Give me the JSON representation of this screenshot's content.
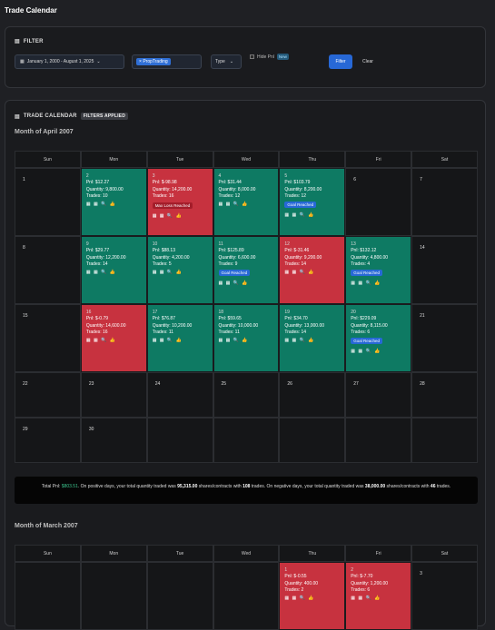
{
  "page_title": "Trade Calendar",
  "filter": {
    "title": "FILTER",
    "date_range": "January 1, 2000 - August 1, 2025",
    "tag": "PropTrading",
    "type_label": "Type",
    "hide_label": "Hide Pnl",
    "new_badge": "New",
    "filter_button": "Filter",
    "clear_button": "Clear"
  },
  "calendar": {
    "title": "TRADE CALENDAR",
    "badge": "FILTERS APPLIED",
    "weekdays": [
      "Sun",
      "Mon",
      "Tue",
      "Wed",
      "Thu",
      "Fri",
      "Sat"
    ]
  },
  "april": {
    "title": "Month of April 2007",
    "days": [
      {
        "d": "1",
        "t": "empty"
      },
      {
        "d": "2",
        "t": "pos",
        "pnl": "Pnl: $12.27",
        "qty": "Quantity: 9,800.00",
        "trades": "Trades: 10"
      },
      {
        "d": "3",
        "t": "neg",
        "pnl": "Pnl: $-98.98",
        "qty": "Quantity: 14,200.00",
        "trades": "Trades: 16",
        "badge": "Max Loss Reached",
        "btype": "loss"
      },
      {
        "d": "4",
        "t": "pos",
        "pnl": "Pnl: $31.44",
        "qty": "Quantity: 8,000.00",
        "trades": "Trades: 12"
      },
      {
        "d": "5",
        "t": "pos",
        "pnl": "Pnl: $103.79",
        "qty": "Quantity: 8,200.00",
        "trades": "Trades: 12",
        "badge": "Goal Reached",
        "btype": "goal"
      },
      {
        "d": "6",
        "t": "empty"
      },
      {
        "d": "7",
        "t": "empty"
      },
      {
        "d": "8",
        "t": "empty"
      },
      {
        "d": "9",
        "t": "pos",
        "pnl": "Pnl: $29.77",
        "qty": "Quantity: 12,200.00",
        "trades": "Trades: 14"
      },
      {
        "d": "10",
        "t": "pos",
        "pnl": "Pnl: $88.13",
        "qty": "Quantity: 4,200.00",
        "trades": "Trades: 5"
      },
      {
        "d": "11",
        "t": "pos",
        "pnl": "Pnl: $125.89",
        "qty": "Quantity: 6,600.00",
        "trades": "Trades: 9",
        "badge": "Goal Reached",
        "btype": "goal"
      },
      {
        "d": "12",
        "t": "neg",
        "pnl": "Pnl: $-31.46",
        "qty": "Quantity: 9,200.00",
        "trades": "Trades: 14"
      },
      {
        "d": "13",
        "t": "pos",
        "pnl": "Pnl: $132.12",
        "qty": "Quantity: 4,800.00",
        "trades": "Trades: 4",
        "badge": "Goal Reached",
        "btype": "goal"
      },
      {
        "d": "14",
        "t": "empty"
      },
      {
        "d": "15",
        "t": "empty"
      },
      {
        "d": "16",
        "t": "neg",
        "pnl": "Pnl: $-0.79",
        "qty": "Quantity: 14,600.00",
        "trades": "Trades: 16"
      },
      {
        "d": "17",
        "t": "pos",
        "pnl": "Pnl: $76.87",
        "qty": "Quantity: 10,200.00",
        "trades": "Trades: 11"
      },
      {
        "d": "18",
        "t": "pos",
        "pnl": "Pnl: $59.65",
        "qty": "Quantity: 10,000.00",
        "trades": "Trades: 11"
      },
      {
        "d": "19",
        "t": "pos",
        "pnl": "Pnl: $34.70",
        "qty": "Quantity: 13,000.00",
        "trades": "Trades: 14"
      },
      {
        "d": "20",
        "t": "pos",
        "pnl": "Pnl: $229.09",
        "qty": "Quantity: 8,115.00",
        "trades": "Trades: 6",
        "badge": "Goal Reached",
        "btype": "goal"
      },
      {
        "d": "21",
        "t": "empty"
      },
      {
        "d": "22",
        "t": "empty"
      },
      {
        "d": "23",
        "t": "empty"
      },
      {
        "d": "24",
        "t": "empty"
      },
      {
        "d": "25",
        "t": "empty"
      },
      {
        "d": "26",
        "t": "empty"
      },
      {
        "d": "27",
        "t": "empty"
      },
      {
        "d": "28",
        "t": "empty"
      },
      {
        "d": "29",
        "t": "empty"
      },
      {
        "d": "30",
        "t": "empty"
      },
      {
        "d": "",
        "t": "blank"
      },
      {
        "d": "",
        "t": "blank"
      },
      {
        "d": "",
        "t": "blank"
      },
      {
        "d": "",
        "t": "blank"
      },
      {
        "d": "",
        "t": "blank"
      }
    ],
    "summary": {
      "p1": "Total Pnl: ",
      "pnl": "$803.51",
      "p2": ". On positive days, your total quantity traded was ",
      "pos_qty": "95,315.00",
      "p3": " shares/contracts with ",
      "pos_trades": "108",
      "p4": " trades. On negative days, your total quantity traded was ",
      "neg_qty": "38,000.00",
      "p5": " shares/contracts with ",
      "neg_trades": "46",
      "p6": " trades."
    }
  },
  "march": {
    "title": "Month of March 2007",
    "days": [
      {
        "d": "",
        "t": "blank"
      },
      {
        "d": "",
        "t": "blank"
      },
      {
        "d": "",
        "t": "blank"
      },
      {
        "d": "",
        "t": "blank"
      },
      {
        "d": "1",
        "t": "neg",
        "pnl": "Pnl: $-0.55",
        "qty": "Quantity: 400.00",
        "trades": "Trades: 2"
      },
      {
        "d": "2",
        "t": "neg",
        "pnl": "Pnl: $-7.70",
        "qty": "Quantity: 1,200.00",
        "trades": "Trades: 6"
      },
      {
        "d": "3",
        "t": "empty"
      }
    ]
  },
  "cell_icons": "▦ ▦ 🔍 👍"
}
